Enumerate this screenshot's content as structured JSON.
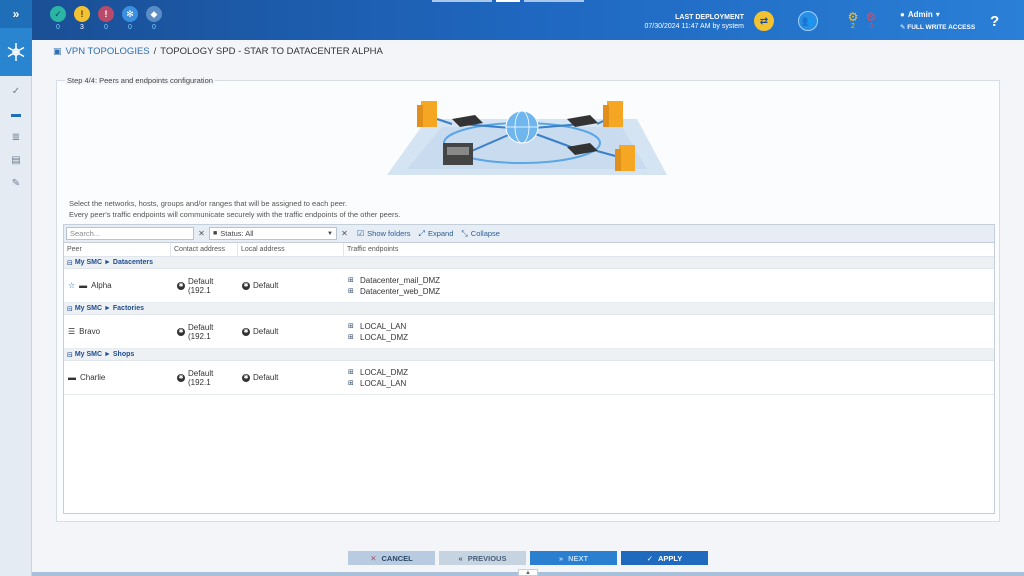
{
  "header": {
    "status_counts": [
      {
        "icon": "check-circle-icon",
        "count": "0",
        "color": "#2bb5a5"
      },
      {
        "icon": "warning-icon",
        "count": "3",
        "color": "#f2c230"
      },
      {
        "icon": "error-icon",
        "count": "0",
        "color": "#b94a6a"
      },
      {
        "icon": "settings-icon",
        "count": "0",
        "color": "#3b8fe0"
      },
      {
        "icon": "box-icon",
        "count": "0",
        "color": "#5a8dc6"
      }
    ],
    "last_deployment_label": "LAST DEPLOYMENT",
    "last_deployment_value": "07/30/2024 11:47 AM by system",
    "gear_counts": [
      "2",
      "0"
    ],
    "admin_name": "Admin",
    "access_label": "FULL WRITE ACCESS",
    "help": "?"
  },
  "breadcrumb": {
    "parent": "VPN TOPOLOGIES",
    "separator": "/",
    "current": "TOPOLOGY SPD - STAR TO DATACENTER ALPHA"
  },
  "panel": {
    "title": "Step 4/4: Peers and endpoints configuration",
    "instruction_1": "Select the networks, hosts, groups and/or ranges that will be assigned to each peer.",
    "instruction_2": "Every peer's traffic endpoints will communicate securely with the traffic endpoints of the other peers."
  },
  "toolbar": {
    "search_placeholder": "Search...",
    "status_value": "Status: All",
    "show_folders": "Show folders",
    "expand": "Expand",
    "collapse": "Collapse"
  },
  "columns": {
    "peer": "Peer",
    "contact": "Contact address",
    "local": "Local address",
    "endpoints": "Traffic endpoints"
  },
  "groups": [
    {
      "path_root": "My SMC",
      "path_leaf": "Datacenters",
      "peer": "Alpha",
      "contact": "Default (192.1",
      "local": "Default",
      "endpoints": [
        "Datacenter_mail_DMZ",
        "Datacenter_web_DMZ"
      ]
    },
    {
      "path_root": "My SMC",
      "path_leaf": "Factories",
      "peer": "Bravo",
      "contact": "Default (192.1",
      "local": "Default",
      "endpoints": [
        "LOCAL_LAN",
        "LOCAL_DMZ"
      ]
    },
    {
      "path_root": "My SMC",
      "path_leaf": "Shops",
      "peer": "Charlie",
      "contact": "Default (192.1",
      "local": "Default",
      "endpoints": [
        "LOCAL_DMZ",
        "LOCAL_LAN"
      ]
    }
  ],
  "buttons": {
    "cancel": "CANCEL",
    "previous": "PREVIOUS",
    "next": "NEXT",
    "apply": "APPLY"
  }
}
